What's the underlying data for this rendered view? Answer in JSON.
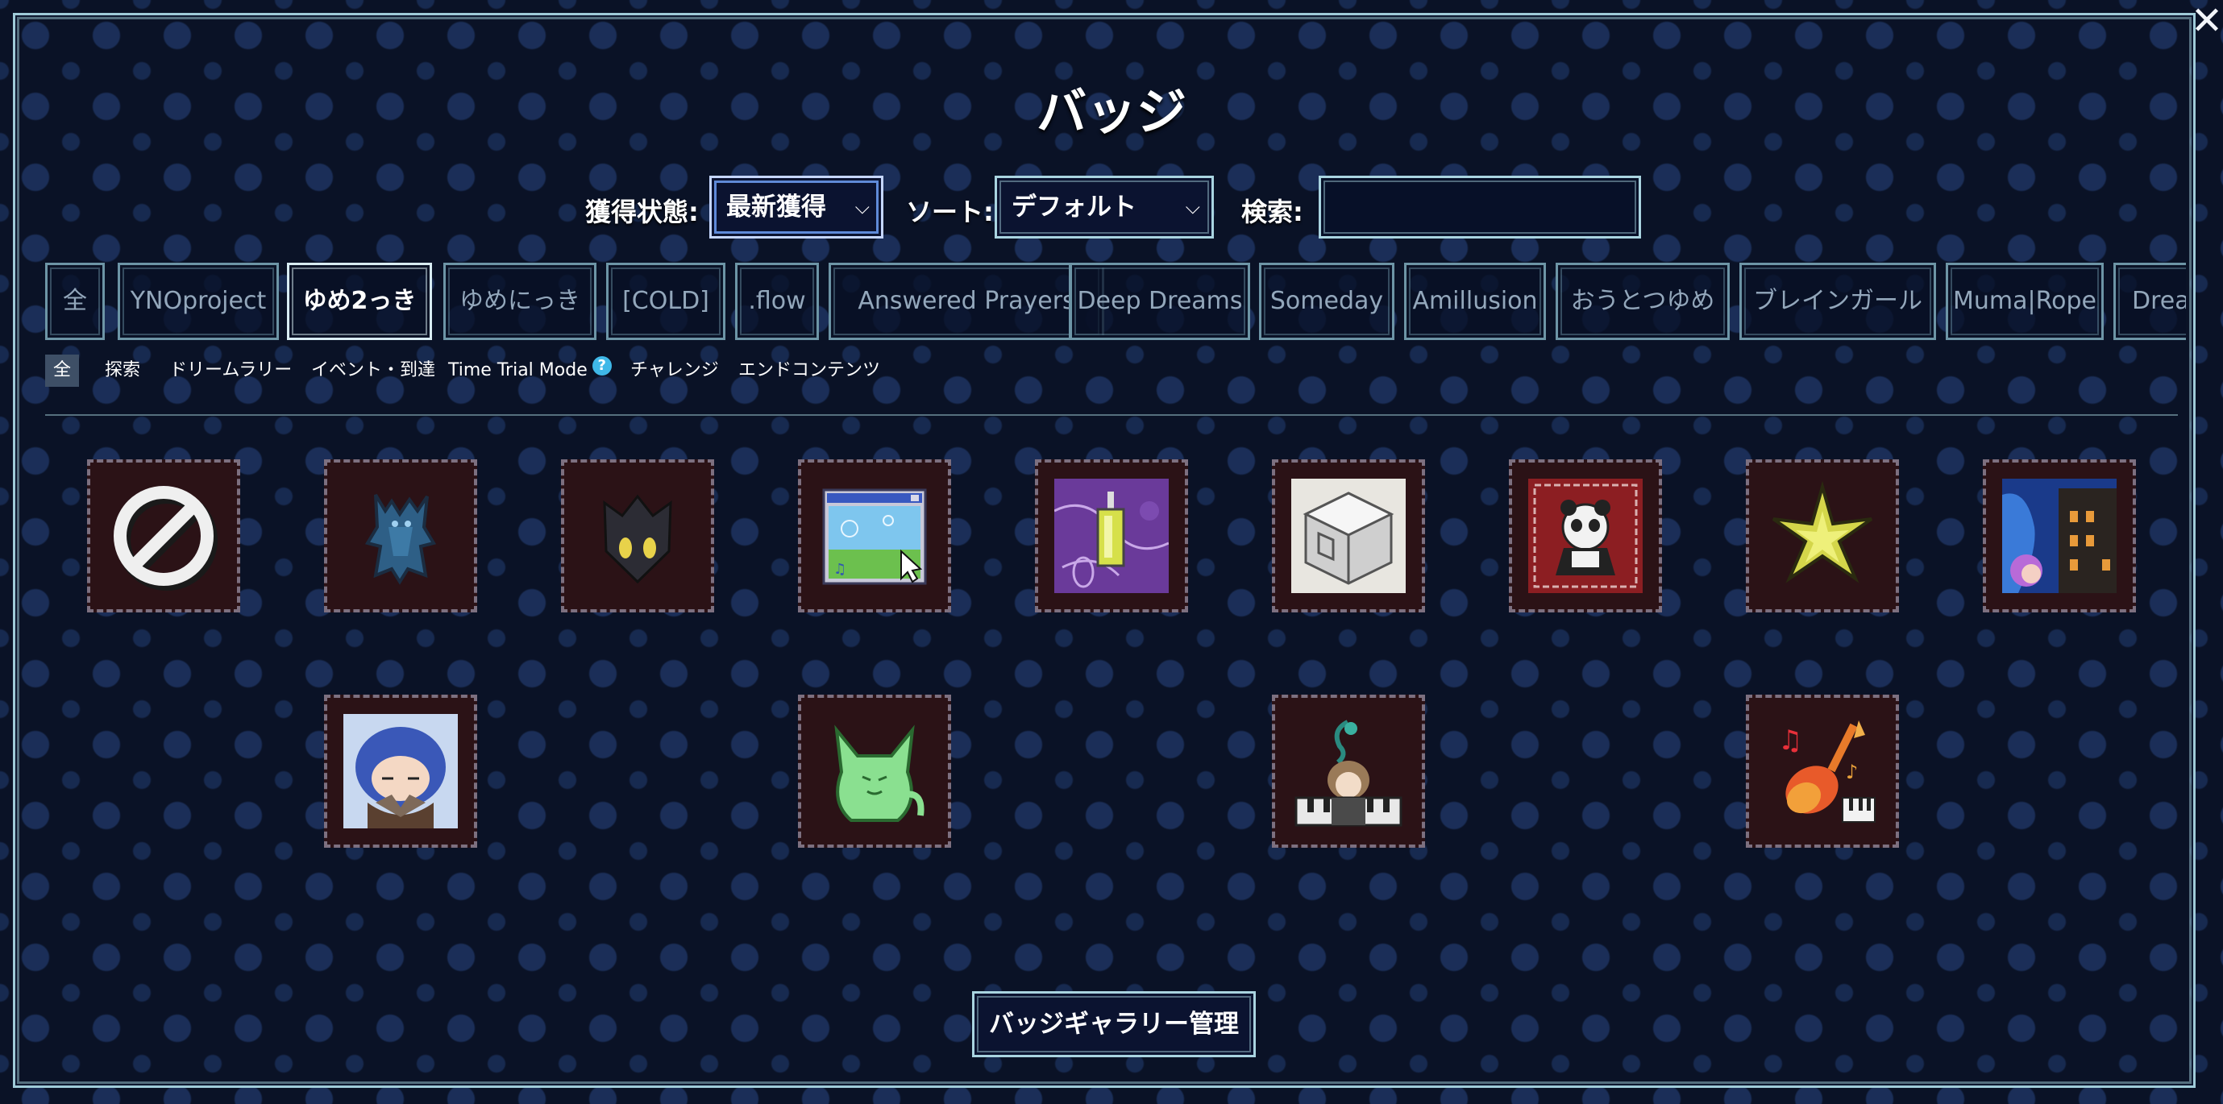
{
  "window": {
    "title": "バッジ",
    "close_label": "✕"
  },
  "filters": {
    "status_label": "獲得状態:",
    "status_value": "最新獲得",
    "sort_label": "ソート:",
    "sort_value": "デフォルト",
    "search_label": "検索:",
    "search_value": "",
    "chevron": "⌵"
  },
  "game_tabs": [
    "全",
    "YNOproject",
    "ゆめ2っき",
    "ゆめにっき",
    "[COLD]",
    ".flow",
    "Answered Prayers",
    "Deep Dreams",
    "Someday",
    "Amillusion",
    "おうとつゆめ",
    "ブレインガール",
    "Muma|Rope",
    "Drea"
  ],
  "active_game_tab": "ゆめ2っき",
  "category_tabs": [
    "全",
    "探索",
    "ドリームラリー",
    "イベント・到達",
    "Time Trial Mode",
    "チャレンジ",
    "エンドコンテンツ"
  ],
  "active_category_tab": "全",
  "help_glyph": "?",
  "badges": [
    {
      "icon": "no-sign"
    },
    {
      "icon": "blue-creature"
    },
    {
      "icon": "shadow-mask"
    },
    {
      "icon": "computer-window"
    },
    {
      "icon": "purple-lantern"
    },
    {
      "icon": "white-cube"
    },
    {
      "icon": "panda-doll"
    },
    {
      "icon": "yellow-star-flower"
    },
    {
      "icon": "purple-hair-girl-city"
    },
    {
      "icon": "blue-hair-girl"
    },
    {
      "icon": "green-cat-creature"
    },
    {
      "icon": "girl-at-piano"
    },
    {
      "icon": "fire-guitar"
    }
  ],
  "manage_button": "バッジギャラリー管理",
  "colors": {
    "background": "#0a1226",
    "frame": "#9fcbd8",
    "badge_bg": "#2b1216"
  }
}
